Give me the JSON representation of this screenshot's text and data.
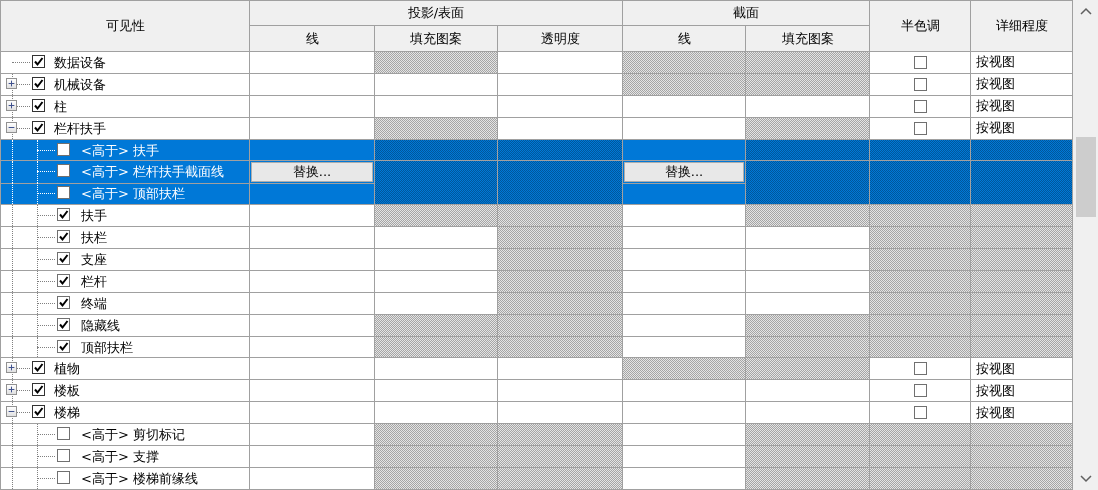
{
  "header": {
    "visibility": "可见性",
    "groups": [
      {
        "label": "投影/表面",
        "columns": [
          "线",
          "填充图案",
          "透明度"
        ]
      },
      {
        "label": "截面",
        "columns": [
          "线",
          "填充图案"
        ]
      }
    ],
    "halftone": "半色调",
    "detail_level": "详细程度"
  },
  "categories": [
    {
      "label": "数据设备",
      "checked": true,
      "selected": false,
      "cells": [
        {
          "kind": "blank"
        },
        {
          "kind": "hatched"
        },
        {
          "kind": "blank"
        },
        {
          "kind": "hatched"
        },
        {
          "kind": "hatched"
        },
        {
          "kind": "checkbox",
          "checked": false
        },
        {
          "kind": "text",
          "text": "按视图"
        }
      ]
    },
    {
      "label": "机械设备",
      "checked": true,
      "selected": false,
      "expanded": false,
      "cells": [
        {
          "kind": "blank"
        },
        {
          "kind": "blank"
        },
        {
          "kind": "blank"
        },
        {
          "kind": "hatched"
        },
        {
          "kind": "hatched"
        },
        {
          "kind": "checkbox",
          "checked": false
        },
        {
          "kind": "text",
          "text": "按视图"
        }
      ]
    },
    {
      "label": "柱",
      "checked": true,
      "selected": false,
      "expanded": false,
      "cells": [
        {
          "kind": "blank"
        },
        {
          "kind": "blank"
        },
        {
          "kind": "blank"
        },
        {
          "kind": "blank"
        },
        {
          "kind": "blank"
        },
        {
          "kind": "checkbox",
          "checked": false
        },
        {
          "kind": "text",
          "text": "按视图"
        }
      ]
    },
    {
      "label": "栏杆扶手",
      "checked": true,
      "selected": false,
      "expanded": true,
      "cells": [
        {
          "kind": "blank"
        },
        {
          "kind": "hatched"
        },
        {
          "kind": "blank"
        },
        {
          "kind": "blank"
        },
        {
          "kind": "hatched"
        },
        {
          "kind": "checkbox",
          "checked": false
        },
        {
          "kind": "text",
          "text": "按视图"
        }
      ],
      "children": [
        {
          "label": "<高于> 扶手",
          "checked": false,
          "selected": true,
          "cells": [
            {
              "kind": "blank"
            },
            {
              "kind": "hatched"
            },
            {
              "kind": "hatched"
            },
            {
              "kind": "blank"
            },
            {
              "kind": "hatched"
            },
            {
              "kind": "hatched"
            },
            {
              "kind": "hatched"
            }
          ]
        },
        {
          "label": "<高于> 栏杆扶手截面线",
          "checked": false,
          "selected": true,
          "cells": [
            {
              "kind": "button",
              "label": "替换..."
            },
            {
              "kind": "hatched"
            },
            {
              "kind": "hatched"
            },
            {
              "kind": "button",
              "label": "替换..."
            },
            {
              "kind": "hatched"
            },
            {
              "kind": "hatched"
            },
            {
              "kind": "hatched"
            }
          ]
        },
        {
          "label": "<高于> 顶部扶栏",
          "checked": false,
          "selected": true,
          "cells": [
            {
              "kind": "blank"
            },
            {
              "kind": "hatched"
            },
            {
              "kind": "hatched"
            },
            {
              "kind": "blank"
            },
            {
              "kind": "hatched"
            },
            {
              "kind": "hatched"
            },
            {
              "kind": "hatched"
            }
          ]
        },
        {
          "label": "扶手",
          "checked": true,
          "selected": false,
          "cells": [
            {
              "kind": "blank"
            },
            {
              "kind": "hatched"
            },
            {
              "kind": "hatched"
            },
            {
              "kind": "blank"
            },
            {
              "kind": "hatched"
            },
            {
              "kind": "hatched"
            },
            {
              "kind": "hatched"
            }
          ]
        },
        {
          "label": "扶栏",
          "checked": true,
          "selected": false,
          "cells": [
            {
              "kind": "blank"
            },
            {
              "kind": "blank"
            },
            {
              "kind": "hatched"
            },
            {
              "kind": "blank"
            },
            {
              "kind": "blank"
            },
            {
              "kind": "hatched"
            },
            {
              "kind": "hatched"
            }
          ]
        },
        {
          "label": "支座",
          "checked": true,
          "selected": false,
          "cells": [
            {
              "kind": "blank"
            },
            {
              "kind": "blank"
            },
            {
              "kind": "hatched"
            },
            {
              "kind": "blank"
            },
            {
              "kind": "blank"
            },
            {
              "kind": "hatched"
            },
            {
              "kind": "hatched"
            }
          ]
        },
        {
          "label": "栏杆",
          "checked": true,
          "selected": false,
          "cells": [
            {
              "kind": "blank"
            },
            {
              "kind": "blank"
            },
            {
              "kind": "hatched"
            },
            {
              "kind": "blank"
            },
            {
              "kind": "blank"
            },
            {
              "kind": "hatched"
            },
            {
              "kind": "hatched"
            }
          ]
        },
        {
          "label": "终端",
          "checked": true,
          "selected": false,
          "cells": [
            {
              "kind": "blank"
            },
            {
              "kind": "blank"
            },
            {
              "kind": "hatched"
            },
            {
              "kind": "blank"
            },
            {
              "kind": "blank"
            },
            {
              "kind": "hatched"
            },
            {
              "kind": "hatched"
            }
          ]
        },
        {
          "label": "隐藏线",
          "checked": true,
          "selected": false,
          "cells": [
            {
              "kind": "blank"
            },
            {
              "kind": "hatched"
            },
            {
              "kind": "hatched"
            },
            {
              "kind": "blank"
            },
            {
              "kind": "hatched"
            },
            {
              "kind": "hatched"
            },
            {
              "kind": "hatched"
            }
          ]
        },
        {
          "label": "顶部扶栏",
          "checked": true,
          "selected": false,
          "cells": [
            {
              "kind": "blank"
            },
            {
              "kind": "hatched"
            },
            {
              "kind": "hatched"
            },
            {
              "kind": "blank"
            },
            {
              "kind": "hatched"
            },
            {
              "kind": "hatched"
            },
            {
              "kind": "hatched"
            }
          ]
        }
      ]
    },
    {
      "label": "植物",
      "checked": true,
      "selected": false,
      "expanded": false,
      "cells": [
        {
          "kind": "blank"
        },
        {
          "kind": "blank"
        },
        {
          "kind": "blank"
        },
        {
          "kind": "hatched"
        },
        {
          "kind": "hatched"
        },
        {
          "kind": "checkbox",
          "checked": false
        },
        {
          "kind": "text",
          "text": "按视图"
        }
      ]
    },
    {
      "label": "楼板",
      "checked": true,
      "selected": false,
      "expanded": false,
      "cells": [
        {
          "kind": "blank"
        },
        {
          "kind": "blank"
        },
        {
          "kind": "blank"
        },
        {
          "kind": "blank"
        },
        {
          "kind": "blank"
        },
        {
          "kind": "checkbox",
          "checked": false
        },
        {
          "kind": "text",
          "text": "按视图"
        }
      ]
    },
    {
      "label": "楼梯",
      "checked": true,
      "selected": false,
      "expanded": true,
      "cells": [
        {
          "kind": "blank"
        },
        {
          "kind": "blank"
        },
        {
          "kind": "blank"
        },
        {
          "kind": "blank"
        },
        {
          "kind": "blank"
        },
        {
          "kind": "checkbox",
          "checked": false
        },
        {
          "kind": "text",
          "text": "按视图"
        }
      ],
      "children": [
        {
          "label": "<高于> 剪切标记",
          "checked": false,
          "selected": false,
          "cells": [
            {
              "kind": "blank"
            },
            {
              "kind": "hatched"
            },
            {
              "kind": "hatched"
            },
            {
              "kind": "blank"
            },
            {
              "kind": "hatched"
            },
            {
              "kind": "hatched"
            },
            {
              "kind": "hatched"
            }
          ]
        },
        {
          "label": "<高于> 支撑",
          "checked": false,
          "selected": false,
          "cells": [
            {
              "kind": "blank"
            },
            {
              "kind": "hatched"
            },
            {
              "kind": "hatched"
            },
            {
              "kind": "blank"
            },
            {
              "kind": "hatched"
            },
            {
              "kind": "hatched"
            },
            {
              "kind": "hatched"
            }
          ]
        },
        {
          "label": "<高于> 楼梯前缘线",
          "checked": false,
          "selected": false,
          "cells": [
            {
              "kind": "blank"
            },
            {
              "kind": "hatched"
            },
            {
              "kind": "hatched"
            },
            {
              "kind": "blank"
            },
            {
              "kind": "hatched"
            },
            {
              "kind": "hatched"
            },
            {
              "kind": "hatched"
            }
          ]
        }
      ]
    }
  ]
}
